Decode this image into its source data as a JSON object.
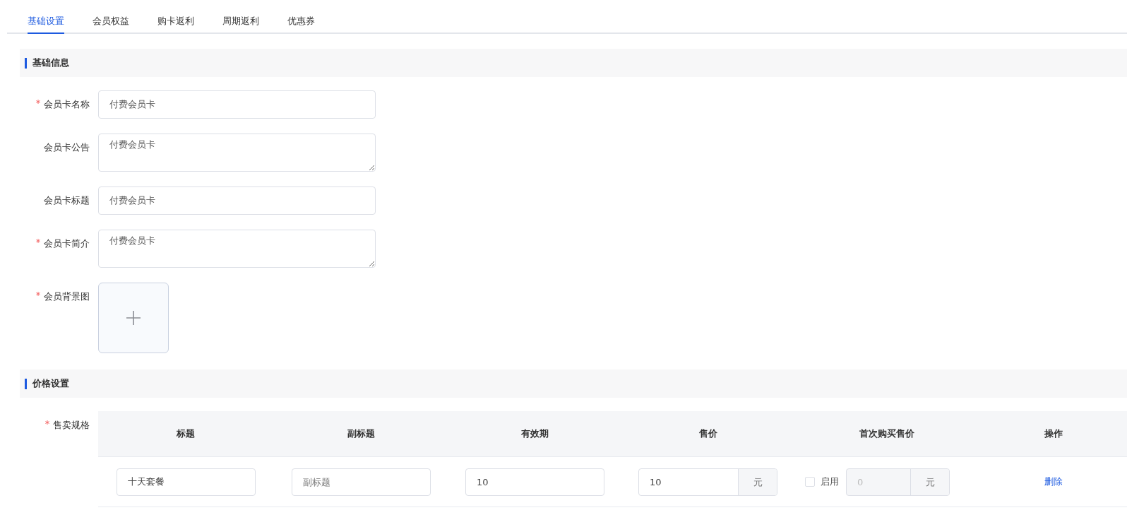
{
  "tabs": [
    {
      "label": "基础设置",
      "selected": true
    },
    {
      "label": "会员权益",
      "selected": false
    },
    {
      "label": "购卡返利",
      "selected": false
    },
    {
      "label": "周期返利",
      "selected": false
    },
    {
      "label": "优惠券",
      "selected": false
    }
  ],
  "basic_section": {
    "title": "基础信息",
    "fields": [
      {
        "kind": "input",
        "label": "会员卡名称",
        "required": true,
        "value": "付费会员卡"
      },
      {
        "kind": "textarea",
        "label": "会员卡公告",
        "required": false,
        "value": "付费会员卡"
      },
      {
        "kind": "input",
        "label": "会员卡标题",
        "required": false,
        "value": "付费会员卡"
      },
      {
        "kind": "textarea",
        "label": "会员卡简介",
        "required": true,
        "value": "付费会员卡"
      },
      {
        "kind": "upload",
        "label": "会员背景图",
        "required": true
      }
    ]
  },
  "price_section": {
    "title": "价格设置",
    "field_label": "售卖规格",
    "required": true,
    "table": {
      "columns": [
        "标题",
        "副标题",
        "有效期",
        "售价",
        "首次购买售价",
        "操作"
      ],
      "rows": [
        {
          "title": "十天套餐",
          "subtitle_placeholder": "副标题",
          "validity": "10",
          "price": "10",
          "price_unit": "元",
          "first_buy_enabled": false,
          "first_buy_label": "启用",
          "first_buy_price": "0",
          "first_buy_unit": "元",
          "action": "删除"
        }
      ]
    }
  }
}
